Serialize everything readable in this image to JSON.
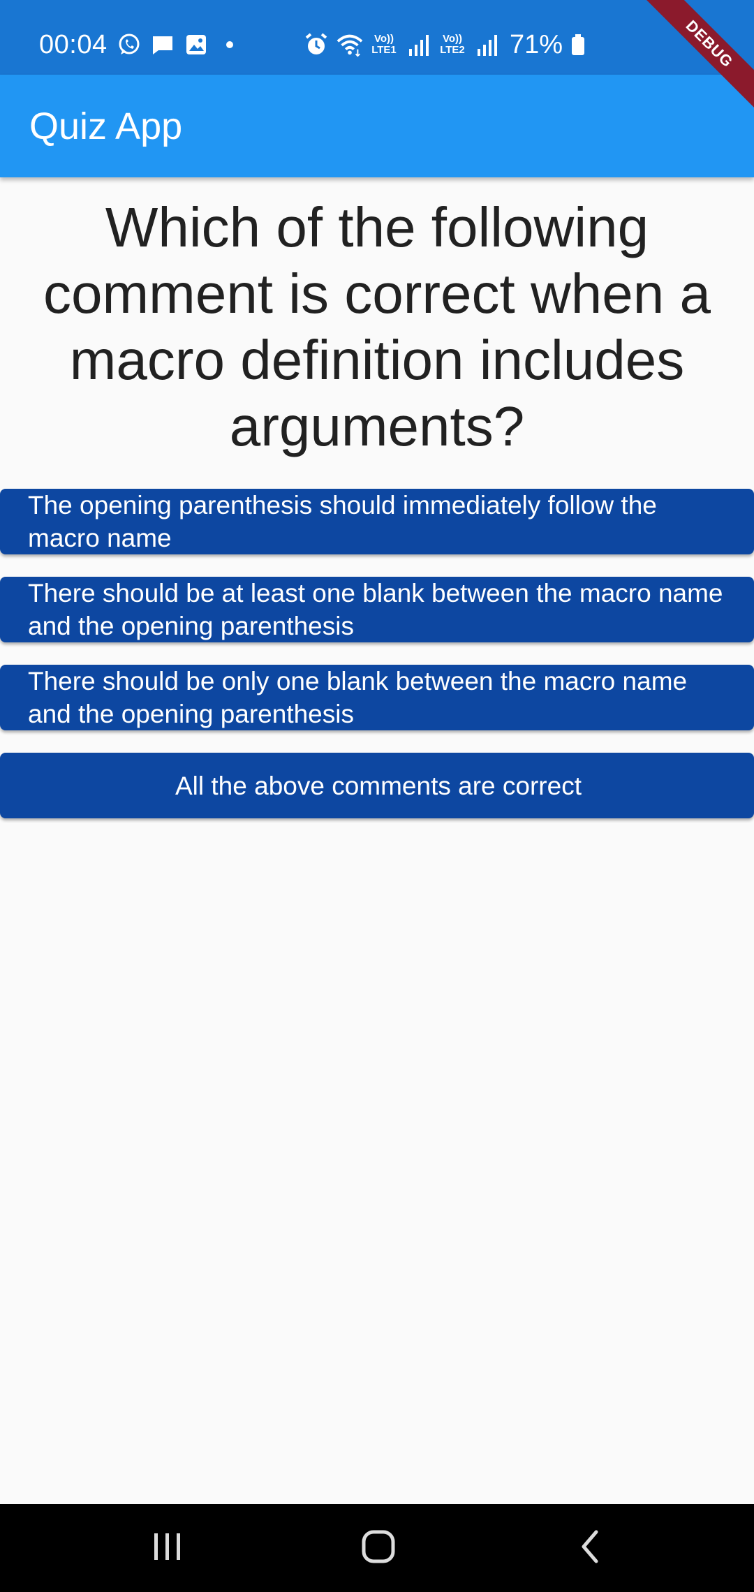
{
  "status_bar": {
    "time": "00:04",
    "battery_percent": "71%",
    "sim1_label_top": "Vo))",
    "sim1_label_bottom": "LTE1",
    "sim2_label_top": "Vo))",
    "sim2_label_bottom": "LTE2",
    "left_icons": [
      "whatsapp-icon",
      "message-icon",
      "gallery-icon",
      "dot-icon"
    ],
    "right_icons": [
      "alarm-icon",
      "wifi-icon",
      "signal-icon",
      "signal-icon",
      "battery-icon"
    ]
  },
  "debug_banner": "DEBUG",
  "app_bar": {
    "title": "Quiz App"
  },
  "question": {
    "text": "Which of the following comment is correct when a macro definition includes arguments?"
  },
  "answers": [
    {
      "label": "The opening parenthesis should immediately follow the macro name"
    },
    {
      "label": "There should be at least one blank between the macro name and the opening parenthesis"
    },
    {
      "label": "There should be only one blank between the macro name and the opening parenthesis"
    },
    {
      "label": "All the above comments are correct"
    }
  ],
  "nav_bar": {
    "icons": [
      "recents-icon",
      "home-icon",
      "back-icon"
    ]
  },
  "colors": {
    "status_bar": "#1976d2",
    "app_bar": "#2196f3",
    "answer_button": "#0d47a1",
    "background": "#fafafa",
    "debug_banner": "#8b1a2c"
  }
}
